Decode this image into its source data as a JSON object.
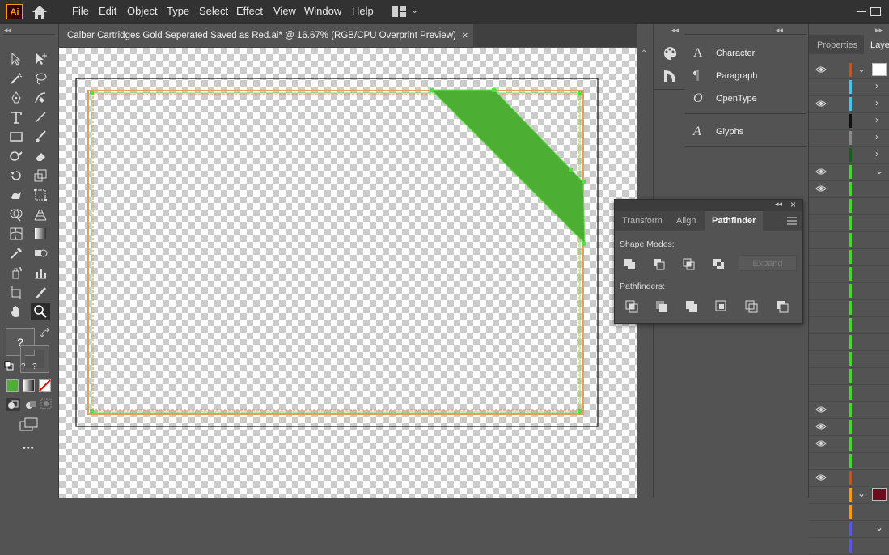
{
  "app": {
    "logo_text": "Ai"
  },
  "menu": [
    "File",
    "Edit",
    "Object",
    "Type",
    "Select",
    "Effect",
    "View",
    "Window",
    "Help"
  ],
  "document": {
    "tab_title": "Calber Cartridges Gold Seperated Saved as Red.ai* @ 16.67% (RGB/CPU Overprint Preview)",
    "close": "×"
  },
  "toolbar": {
    "fill_stroke_unknown": "?",
    "small_q1": "?",
    "small_q2": "?",
    "more": "•••"
  },
  "dock_panels": [
    {
      "icon": "A",
      "label": "Character"
    },
    {
      "icon": "¶",
      "label": "Paragraph"
    },
    {
      "icon": "O",
      "label": "OpenType"
    },
    {
      "icon": "A",
      "label": "Glyphs"
    }
  ],
  "right_panel": {
    "tabs": [
      "Properties",
      "Layer"
    ],
    "layers": [
      {
        "eye": true,
        "color": "#b3592b",
        "chevron": "down",
        "thumb": "white"
      },
      {
        "eye": false,
        "color": "#4fc1e9",
        "chevron": "right"
      },
      {
        "eye": true,
        "color": "#4fc1e9",
        "chevron": "right"
      },
      {
        "eye": false,
        "color": "#111111",
        "chevron": "right"
      },
      {
        "eye": false,
        "color": "#888888",
        "chevron": "right"
      },
      {
        "eye": false,
        "color": "#1a5a1a",
        "chevron": "right"
      },
      {
        "eye": true,
        "color": "#4cd137",
        "chevron": "down"
      },
      {
        "eye": true,
        "color": "#4cd137",
        "chevron": ""
      },
      {
        "eye": false,
        "color": "#4cd137",
        "chevron": ""
      },
      {
        "eye": false,
        "color": "#4cd137",
        "chevron": ""
      },
      {
        "eye": false,
        "color": "#4cd137",
        "chevron": ""
      },
      {
        "eye": false,
        "color": "#4cd137",
        "chevron": ""
      },
      {
        "eye": false,
        "color": "#4cd137",
        "chevron": ""
      },
      {
        "eye": false,
        "color": "#4cd137",
        "chevron": ""
      },
      {
        "eye": false,
        "color": "#4cd137",
        "chevron": ""
      },
      {
        "eye": false,
        "color": "#4cd137",
        "chevron": ""
      },
      {
        "eye": false,
        "color": "#4cd137",
        "chevron": ""
      },
      {
        "eye": false,
        "color": "#4cd137",
        "chevron": ""
      },
      {
        "eye": false,
        "color": "#4cd137",
        "chevron": ""
      },
      {
        "eye": false,
        "color": "#4cd137",
        "chevron": ""
      },
      {
        "eye": true,
        "color": "#4cd137",
        "chevron": ""
      },
      {
        "eye": true,
        "color": "#4cd137",
        "chevron": ""
      },
      {
        "eye": true,
        "color": "#4cd137",
        "chevron": ""
      },
      {
        "eye": false,
        "color": "#4cd137",
        "chevron": ""
      },
      {
        "eye": true,
        "color": "#b3592b",
        "chevron": ""
      },
      {
        "eye": false,
        "color": "#f39c12",
        "chevron": "down",
        "thumb": "maroon"
      },
      {
        "eye": false,
        "color": "#f39c12",
        "chevron": ""
      },
      {
        "eye": false,
        "color": "#5a5ad8",
        "chevron": "down"
      },
      {
        "eye": false,
        "color": "#5a5ad8",
        "chevron": ""
      }
    ]
  },
  "pathfinder": {
    "tabs": [
      "Transform",
      "Align",
      "Pathfinder"
    ],
    "active_tab": "Pathfinder",
    "shape_modes_label": "Shape Modes:",
    "pathfinders_label": "Pathfinders:",
    "expand_label": "Expand"
  },
  "colors": {
    "accent_green": "#4cae33",
    "border_orange": "#e0a060"
  }
}
